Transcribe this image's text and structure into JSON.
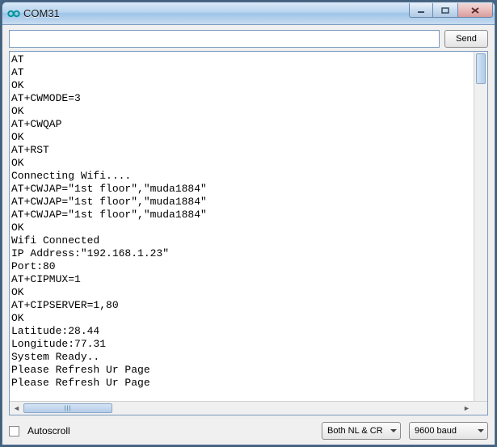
{
  "window": {
    "title": "COM31"
  },
  "toolbar": {
    "send_label": "Send",
    "input_value": ""
  },
  "console_lines": [
    "AT",
    "AT",
    "OK",
    "AT+CWMODE=3",
    "OK",
    "AT+CWQAP",
    "OK",
    "AT+RST",
    "OK",
    "Connecting Wifi....",
    "AT+CWJAP=\"1st floor\",\"muda1884\"",
    "AT+CWJAP=\"1st floor\",\"muda1884\"",
    "AT+CWJAP=\"1st floor\",\"muda1884\"",
    "OK",
    "Wifi Connected",
    "IP Address:\"192.168.1.23\"",
    "Port:80",
    "AT+CIPMUX=1",
    "OK",
    "AT+CIPSERVER=1,80",
    "OK",
    "Latitude:28.44",
    "Longitude:77.31",
    "System Ready..",
    "Please Refresh Ur Page",
    "Please Refresh Ur Page"
  ],
  "footer": {
    "autoscroll_label": "Autoscroll",
    "autoscroll_checked": false,
    "line_ending_selected": "Both NL & CR",
    "baud_selected": "9600 baud"
  }
}
